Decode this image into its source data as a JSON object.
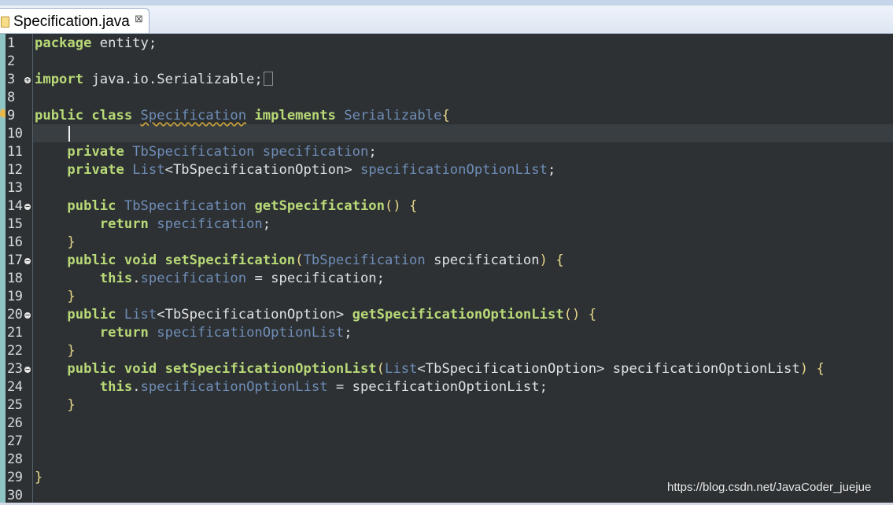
{
  "editor_tab": {
    "title": "Specification.java",
    "close_symbol": "⊠",
    "icon": "java-file-icon"
  },
  "code_lines": [
    {
      "num": "1",
      "fold": "",
      "tokens": [
        [
          "kw",
          "package"
        ],
        [
          "pl",
          " entity;"
        ]
      ]
    },
    {
      "num": "2",
      "fold": "",
      "tokens": []
    },
    {
      "num": "3",
      "fold": "+",
      "tokens": [
        [
          "kw",
          "import"
        ],
        [
          "pl",
          " java.io.Serializable;"
        ]
      ],
      "folded_marker": true
    },
    {
      "num": "8",
      "fold": "",
      "tokens": []
    },
    {
      "num": "9",
      "fold": "",
      "tokens": [
        [
          "kw",
          "public class "
        ],
        [
          "ty und",
          "Specification"
        ],
        [
          "pl",
          " "
        ],
        [
          "kw",
          "implements"
        ],
        [
          "pl",
          " "
        ],
        [
          "ty",
          "Serializable"
        ],
        [
          "br",
          "{"
        ]
      ]
    },
    {
      "num": "10",
      "fold": "",
      "tokens": [
        [
          "pl",
          "    "
        ]
      ]
    },
    {
      "num": "11",
      "fold": "",
      "tokens": [
        [
          "pl",
          "    "
        ],
        [
          "kw",
          "private"
        ],
        [
          "pl",
          " "
        ],
        [
          "ty",
          "TbSpecification"
        ],
        [
          "pl",
          " "
        ],
        [
          "fi",
          "specification"
        ],
        [
          "pl",
          ";"
        ]
      ]
    },
    {
      "num": "12",
      "fold": "",
      "tokens": [
        [
          "pl",
          "    "
        ],
        [
          "kw",
          "private"
        ],
        [
          "pl",
          " "
        ],
        [
          "ty",
          "List"
        ],
        [
          "pl",
          "<TbSpecificationOption> "
        ],
        [
          "fi",
          "specificationOptionList"
        ],
        [
          "pl",
          ";"
        ]
      ]
    },
    {
      "num": "13",
      "fold": "",
      "tokens": []
    },
    {
      "num": "14",
      "fold": "-",
      "tokens": [
        [
          "pl",
          "    "
        ],
        [
          "kw",
          "public"
        ],
        [
          "pl",
          " "
        ],
        [
          "ty",
          "TbSpecification"
        ],
        [
          "pl",
          " "
        ],
        [
          "fn",
          "getSpecification"
        ],
        [
          "br",
          "()"
        ],
        [
          "pl",
          " "
        ],
        [
          "br",
          "{"
        ]
      ]
    },
    {
      "num": "15",
      "fold": "",
      "tokens": [
        [
          "pl",
          "        "
        ],
        [
          "kw",
          "return"
        ],
        [
          "pl",
          " "
        ],
        [
          "fi",
          "specification"
        ],
        [
          "pl",
          ";"
        ]
      ]
    },
    {
      "num": "16",
      "fold": "",
      "tokens": [
        [
          "pl",
          "    "
        ],
        [
          "br",
          "}"
        ]
      ]
    },
    {
      "num": "17",
      "fold": "-",
      "tokens": [
        [
          "pl",
          "    "
        ],
        [
          "kw",
          "public void"
        ],
        [
          "pl",
          " "
        ],
        [
          "fn",
          "setSpecification"
        ],
        [
          "br",
          "("
        ],
        [
          "ty",
          "TbSpecification"
        ],
        [
          "pl",
          " specification"
        ],
        [
          "br",
          ")"
        ],
        [
          "pl",
          " "
        ],
        [
          "br",
          "{"
        ]
      ]
    },
    {
      "num": "18",
      "fold": "",
      "tokens": [
        [
          "pl",
          "        "
        ],
        [
          "kw",
          "this"
        ],
        [
          "pl",
          "."
        ],
        [
          "fi",
          "specification"
        ],
        [
          "pl",
          " = specification;"
        ]
      ]
    },
    {
      "num": "19",
      "fold": "",
      "tokens": [
        [
          "pl",
          "    "
        ],
        [
          "br",
          "}"
        ]
      ]
    },
    {
      "num": "20",
      "fold": "-",
      "tokens": [
        [
          "pl",
          "    "
        ],
        [
          "kw",
          "public"
        ],
        [
          "pl",
          " "
        ],
        [
          "ty",
          "List"
        ],
        [
          "pl",
          "<TbSpecificationOption> "
        ],
        [
          "fn",
          "getSpecificationOptionList"
        ],
        [
          "br",
          "()"
        ],
        [
          "pl",
          " "
        ],
        [
          "br",
          "{"
        ]
      ]
    },
    {
      "num": "21",
      "fold": "",
      "tokens": [
        [
          "pl",
          "        "
        ],
        [
          "kw",
          "return"
        ],
        [
          "pl",
          " "
        ],
        [
          "fi",
          "specificationOptionList"
        ],
        [
          "pl",
          ";"
        ]
      ]
    },
    {
      "num": "22",
      "fold": "",
      "tokens": [
        [
          "pl",
          "    "
        ],
        [
          "br",
          "}"
        ]
      ]
    },
    {
      "num": "23",
      "fold": "-",
      "tokens": [
        [
          "pl",
          "    "
        ],
        [
          "kw",
          "public void"
        ],
        [
          "pl",
          " "
        ],
        [
          "fn",
          "setSpecificationOptionList"
        ],
        [
          "br",
          "("
        ],
        [
          "ty",
          "List"
        ],
        [
          "pl",
          "<TbSpecificationOption> specificationOptionList"
        ],
        [
          "br",
          ")"
        ],
        [
          "pl",
          " "
        ],
        [
          "br",
          "{"
        ]
      ]
    },
    {
      "num": "24",
      "fold": "",
      "tokens": [
        [
          "pl",
          "        "
        ],
        [
          "kw",
          "this"
        ],
        [
          "pl",
          "."
        ],
        [
          "fi",
          "specificationOptionList"
        ],
        [
          "pl",
          " = specificationOptionList;"
        ]
      ]
    },
    {
      "num": "25",
      "fold": "",
      "tokens": [
        [
          "pl",
          "    "
        ],
        [
          "br",
          "}"
        ]
      ]
    },
    {
      "num": "26",
      "fold": "",
      "tokens": []
    },
    {
      "num": "27",
      "fold": "",
      "tokens": []
    },
    {
      "num": "28",
      "fold": "",
      "tokens": []
    },
    {
      "num": "29",
      "fold": "",
      "tokens": [
        [
          "br",
          "}"
        ]
      ]
    },
    {
      "num": "30",
      "fold": "",
      "tokens": []
    }
  ],
  "watermark": "https://blog.csdn.net/JavaCoder_juejue",
  "colors": {
    "editor_background": "#2d3133",
    "keyword": "#b8d977",
    "type": "#6f8db8",
    "plain": "#e0e2e4",
    "bracket": "#e8d98b"
  }
}
